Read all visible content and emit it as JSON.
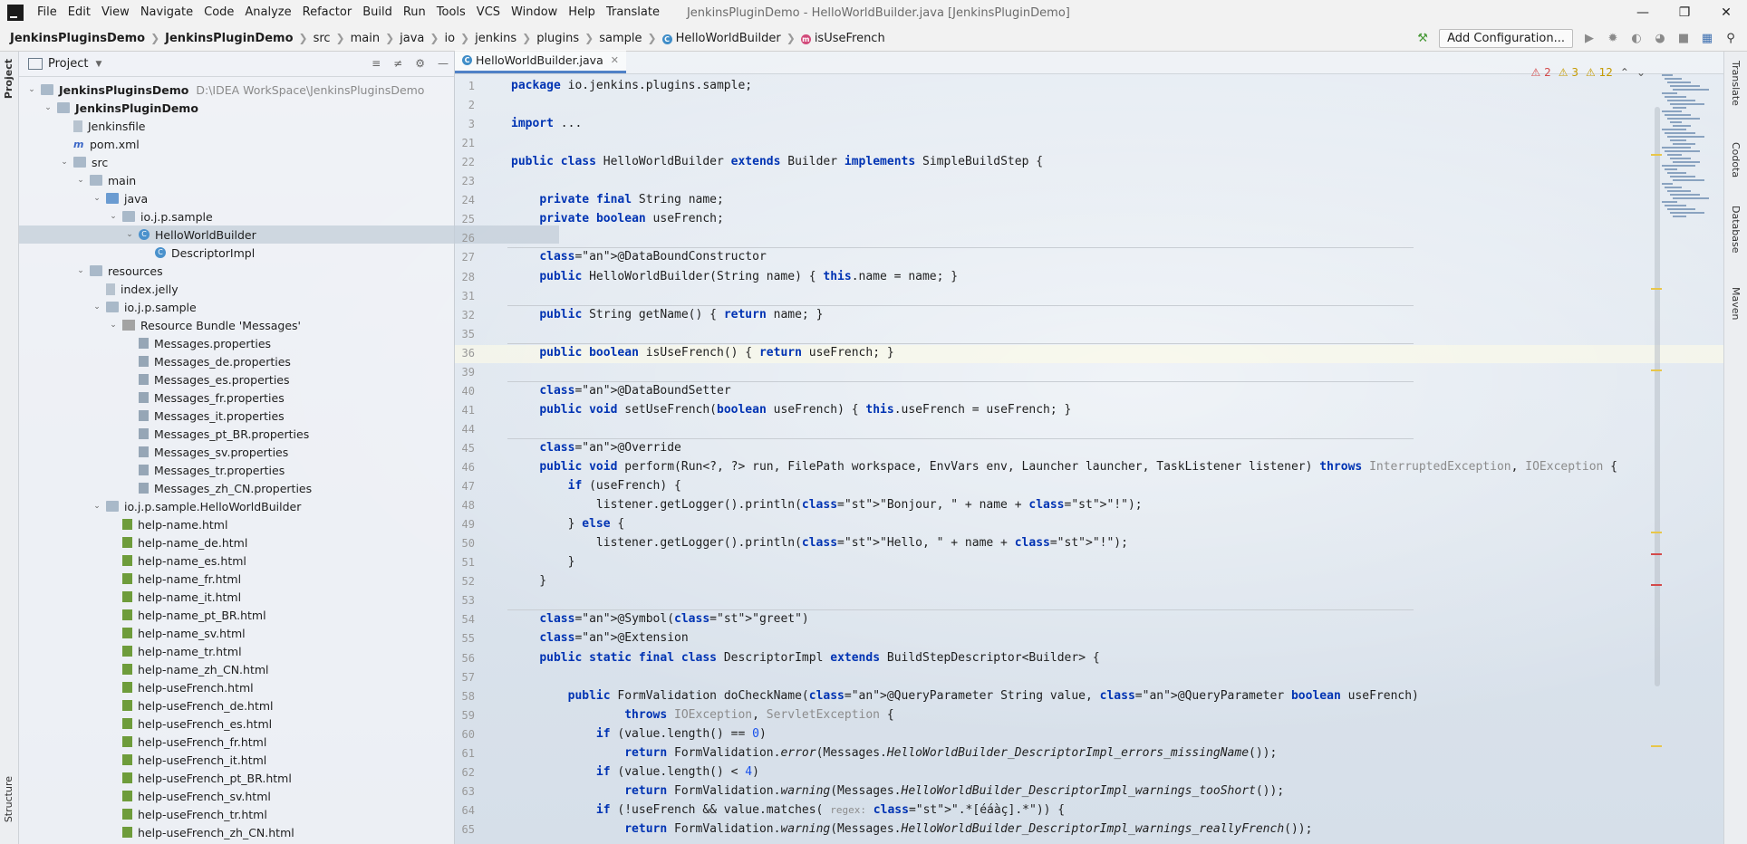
{
  "menu": [
    "File",
    "Edit",
    "View",
    "Navigate",
    "Code",
    "Analyze",
    "Refactor",
    "Build",
    "Run",
    "Tools",
    "VCS",
    "Window",
    "Help",
    "Translate"
  ],
  "window_title": "JenkinsPluginDemo - HelloWorldBuilder.java [JenkinsPluginDemo]",
  "breadcrumbs": [
    "JenkinsPluginsDemo",
    "JenkinsPluginDemo",
    "src",
    "main",
    "java",
    "io",
    "jenkins",
    "plugins",
    "sample",
    "HelloWorldBuilder",
    "isUseFrench"
  ],
  "toolbar": {
    "add_configuration": "Add Configuration..."
  },
  "left_strip": {
    "project": "Project",
    "structure": "Structure"
  },
  "right_strip": [
    "Translate",
    "Codota",
    "Database",
    "Maven"
  ],
  "project_panel": {
    "title": "Project",
    "tree": [
      {
        "label": "JenkinsPluginsDemo",
        "path": "D:\\IDEA WorkSpace\\JenkinsPluginsDemo",
        "depth": 0,
        "arrow": "v",
        "icon": "folder",
        "bold": true
      },
      {
        "label": "JenkinsPluginDemo",
        "depth": 1,
        "arrow": "v",
        "icon": "folder",
        "bold": true
      },
      {
        "label": "Jenkinsfile",
        "depth": 2,
        "arrow": "",
        "icon": "file"
      },
      {
        "label": "pom.xml",
        "depth": 2,
        "arrow": "",
        "icon": "maven"
      },
      {
        "label": "src",
        "depth": 2,
        "arrow": "v",
        "icon": "folder"
      },
      {
        "label": "main",
        "depth": 3,
        "arrow": "v",
        "icon": "folder"
      },
      {
        "label": "java",
        "depth": 4,
        "arrow": "v",
        "icon": "folder-blue"
      },
      {
        "label": "io.j.p.sample",
        "depth": 5,
        "arrow": "v",
        "icon": "folder"
      },
      {
        "label": "HelloWorldBuilder",
        "depth": 6,
        "arrow": "v",
        "icon": "class",
        "selected": true
      },
      {
        "label": "DescriptorImpl",
        "depth": 7,
        "arrow": "",
        "icon": "class"
      },
      {
        "label": "resources",
        "depth": 3,
        "arrow": "v",
        "icon": "folder"
      },
      {
        "label": "index.jelly",
        "depth": 4,
        "arrow": "",
        "icon": "file"
      },
      {
        "label": "io.j.p.sample",
        "depth": 4,
        "arrow": "v",
        "icon": "folder"
      },
      {
        "label": "Resource Bundle 'Messages'",
        "depth": 5,
        "arrow": "v",
        "icon": "bundle"
      },
      {
        "label": "Messages.properties",
        "depth": 6,
        "arrow": "",
        "icon": "props"
      },
      {
        "label": "Messages_de.properties",
        "depth": 6,
        "arrow": "",
        "icon": "props"
      },
      {
        "label": "Messages_es.properties",
        "depth": 6,
        "arrow": "",
        "icon": "props"
      },
      {
        "label": "Messages_fr.properties",
        "depth": 6,
        "arrow": "",
        "icon": "props"
      },
      {
        "label": "Messages_it.properties",
        "depth": 6,
        "arrow": "",
        "icon": "props"
      },
      {
        "label": "Messages_pt_BR.properties",
        "depth": 6,
        "arrow": "",
        "icon": "props"
      },
      {
        "label": "Messages_sv.properties",
        "depth": 6,
        "arrow": "",
        "icon": "props"
      },
      {
        "label": "Messages_tr.properties",
        "depth": 6,
        "arrow": "",
        "icon": "props"
      },
      {
        "label": "Messages_zh_CN.properties",
        "depth": 6,
        "arrow": "",
        "icon": "props"
      },
      {
        "label": "io.j.p.sample.HelloWorldBuilder",
        "depth": 4,
        "arrow": "v",
        "icon": "folder"
      },
      {
        "label": "help-name.html",
        "depth": 5,
        "arrow": "",
        "icon": "html"
      },
      {
        "label": "help-name_de.html",
        "depth": 5,
        "arrow": "",
        "icon": "html"
      },
      {
        "label": "help-name_es.html",
        "depth": 5,
        "arrow": "",
        "icon": "html"
      },
      {
        "label": "help-name_fr.html",
        "depth": 5,
        "arrow": "",
        "icon": "html"
      },
      {
        "label": "help-name_it.html",
        "depth": 5,
        "arrow": "",
        "icon": "html"
      },
      {
        "label": "help-name_pt_BR.html",
        "depth": 5,
        "arrow": "",
        "icon": "html"
      },
      {
        "label": "help-name_sv.html",
        "depth": 5,
        "arrow": "",
        "icon": "html"
      },
      {
        "label": "help-name_tr.html",
        "depth": 5,
        "arrow": "",
        "icon": "html"
      },
      {
        "label": "help-name_zh_CN.html",
        "depth": 5,
        "arrow": "",
        "icon": "html"
      },
      {
        "label": "help-useFrench.html",
        "depth": 5,
        "arrow": "",
        "icon": "html"
      },
      {
        "label": "help-useFrench_de.html",
        "depth": 5,
        "arrow": "",
        "icon": "html"
      },
      {
        "label": "help-useFrench_es.html",
        "depth": 5,
        "arrow": "",
        "icon": "html"
      },
      {
        "label": "help-useFrench_fr.html",
        "depth": 5,
        "arrow": "",
        "icon": "html"
      },
      {
        "label": "help-useFrench_it.html",
        "depth": 5,
        "arrow": "",
        "icon": "html"
      },
      {
        "label": "help-useFrench_pt_BR.html",
        "depth": 5,
        "arrow": "",
        "icon": "html"
      },
      {
        "label": "help-useFrench_sv.html",
        "depth": 5,
        "arrow": "",
        "icon": "html"
      },
      {
        "label": "help-useFrench_tr.html",
        "depth": 5,
        "arrow": "",
        "icon": "html"
      },
      {
        "label": "help-useFrench_zh_CN.html",
        "depth": 5,
        "arrow": "",
        "icon": "html"
      }
    ]
  },
  "editor": {
    "tab": "HelloWorldBuilder.java",
    "inspections": {
      "errors": "2",
      "warnings": "3",
      "weak": "12"
    },
    "line_numbers": [
      "1",
      "2",
      "3",
      "21",
      "22",
      "23",
      "24",
      "25",
      "26",
      "27",
      "28",
      "31",
      "32",
      "35",
      "36",
      "39",
      "40",
      "41",
      "44",
      "45",
      "46",
      "47",
      "48",
      "49",
      "50",
      "51",
      "52",
      "53",
      "54",
      "55",
      "56",
      "57",
      "58",
      "59",
      "60",
      "61",
      "62",
      "63",
      "64",
      "65"
    ],
    "code": [
      "package io.jenkins.plugins.sample;",
      "",
      "import ...",
      "",
      "public class HelloWorldBuilder extends Builder implements SimpleBuildStep {",
      "",
      "    private final String name;",
      "    private boolean useFrench;",
      "",
      "    @DataBoundConstructor",
      "    public HelloWorldBuilder(String name) { this.name = name; }",
      "",
      "    public String getName() { return name; }",
      "",
      "    public boolean isUseFrench() { return useFrench; }",
      "",
      "    @DataBoundSetter",
      "    public void setUseFrench(boolean useFrench) { this.useFrench = useFrench; }",
      "",
      "    @Override",
      "    public void perform(Run<?, ?> run, FilePath workspace, EnvVars env, Launcher launcher, TaskListener listener) throws InterruptedException, IOException {",
      "        if (useFrench) {",
      "            listener.getLogger().println(\"Bonjour, \" + name + \"!\");",
      "        } else {",
      "            listener.getLogger().println(\"Hello, \" + name + \"!\");",
      "        }",
      "    }",
      "",
      "    @Symbol(\"greet\")",
      "    @Extension",
      "    public static final class DescriptorImpl extends BuildStepDescriptor<Builder> {",
      "",
      "        public FormValidation doCheckName(@QueryParameter String value, @QueryParameter boolean useFrench)",
      "                throws IOException, ServletException {",
      "            if (value.length() == 0)",
      "                return FormValidation.error(Messages.HelloWorldBuilder_DescriptorImpl_errors_missingName());",
      "            if (value.length() < 4)",
      "                return FormValidation.warning(Messages.HelloWorldBuilder_DescriptorImpl_warnings_tooShort());",
      "            if (!useFrench && value.matches( regex: \".*[éáàç].*\")) {",
      "                return FormValidation.warning(Messages.HelloWorldBuilder_DescriptorImpl_warnings_reallyFrench());"
    ]
  }
}
